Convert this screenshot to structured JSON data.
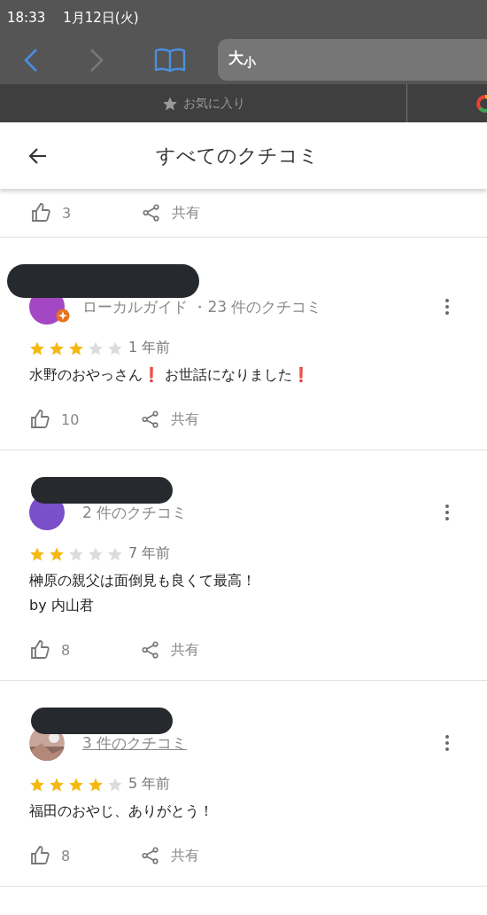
{
  "status_bar": {
    "time": "18:33",
    "date": "1月12日(火)"
  },
  "browser_toolbar": {
    "back_enabled": true,
    "forward_enabled": false,
    "text_size": "大$_{小}$"
  },
  "favorites_bar": {
    "label": "お気に入り"
  },
  "header": {
    "title": "すべてのクチコミ"
  },
  "partial_review": {
    "likes": "3",
    "share": "共有"
  },
  "reviews": [
    {
      "avatar": {
        "kind": "plain",
        "color": "#a447c4"
      },
      "local_guide": true,
      "meta": "ローカルガイド ・23 件のクチコミ",
      "meta_link": false,
      "stars": 3,
      "time": "1 年前",
      "text": "水野のおやっさん❗ お世話になりました❗",
      "likes": "10",
      "share": "共有"
    },
    {
      "avatar": {
        "kind": "plain",
        "color": "#7b4fc9"
      },
      "local_guide": false,
      "meta": "2 件のクチコミ",
      "meta_link": false,
      "stars": 2,
      "time": "7 年前",
      "text": "榊原の親父は面倒見も良くて最高！\nby  内山君",
      "likes": "8",
      "share": "共有"
    },
    {
      "local_guide": false,
      "meta": "3 件のクチコミ",
      "meta_link": true,
      "stars": 4,
      "time": "5 年前",
      "text": "福田のおやじ、ありがとう！",
      "likes": "8",
      "share": "共有"
    }
  ]
}
